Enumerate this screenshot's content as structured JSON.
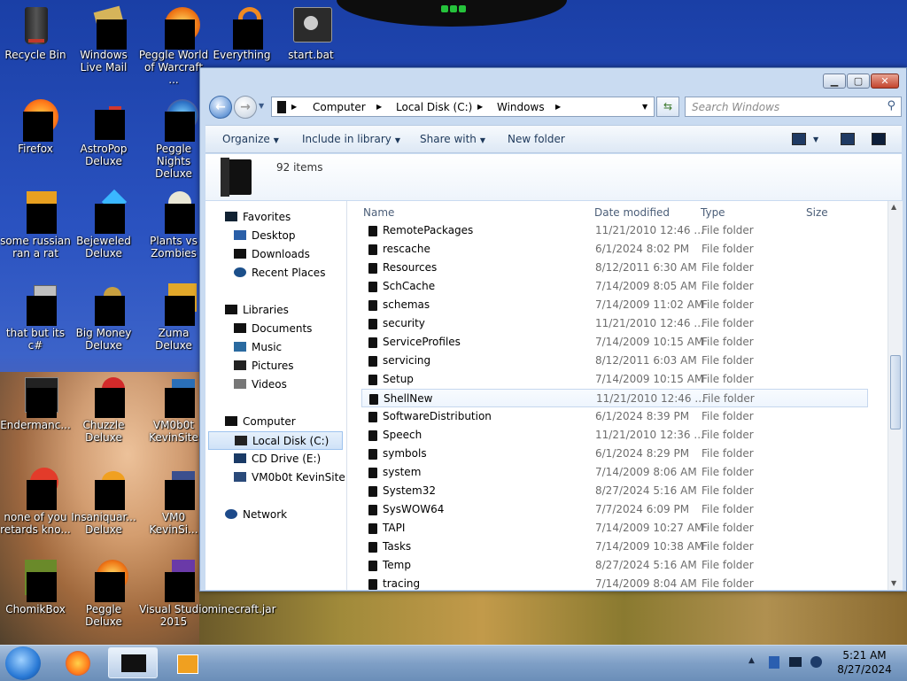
{
  "desktop": {
    "icons": [
      {
        "name": "recycle-bin",
        "label": "Recycle Bin"
      },
      {
        "name": "windows-live-mail",
        "label": "Windows Live Mail"
      },
      {
        "name": "peggle-world-of-warcraft",
        "label": "Peggle World of Warcraft ..."
      },
      {
        "name": "everything",
        "label": "Everything"
      },
      {
        "name": "start-bat",
        "label": "start.bat"
      },
      {
        "name": "firefox",
        "label": "Firefox"
      },
      {
        "name": "astropop-deluxe",
        "label": "AstroPop Deluxe"
      },
      {
        "name": "peggle-nights-deluxe",
        "label": "Peggle Nights Deluxe"
      },
      {
        "name": "some-russian-ran-a-rat",
        "label": "some russian ran a rat"
      },
      {
        "name": "bejeweled-deluxe",
        "label": "Bejeweled Deluxe"
      },
      {
        "name": "plants-vs-zombies",
        "label": "Plants vs Zombies"
      },
      {
        "name": "that-but-its-csharp",
        "label": "that but its c#"
      },
      {
        "name": "big-money-deluxe",
        "label": "Big Money Deluxe"
      },
      {
        "name": "zuma-deluxe",
        "label": "Zuma Deluxe"
      },
      {
        "name": "endermanc",
        "label": "Endermanc..."
      },
      {
        "name": "chuzzle-deluxe",
        "label": "Chuzzle Deluxe"
      },
      {
        "name": "vm0b0t-kevinsite",
        "label": "VM0b0t KevinSite"
      },
      {
        "name": "none-of-you",
        "label": "none of you retards kno..."
      },
      {
        "name": "insaniquarium-deluxe",
        "label": "Insaniquar... Deluxe"
      },
      {
        "name": "vm0-kevinsi",
        "label": "VM0 KevinSi..."
      },
      {
        "name": "chomikbox",
        "label": "ChomikBox"
      },
      {
        "name": "peggle-deluxe",
        "label": "Peggle Deluxe"
      },
      {
        "name": "visual-studio-2015",
        "label": "Visual Studio 2015"
      },
      {
        "name": "minecraft-jar",
        "label": "minecraft.jar"
      }
    ]
  },
  "explorer": {
    "breadcrumb": [
      "Computer",
      "Local Disk (C:)",
      "Windows"
    ],
    "search_placeholder": "Search Windows",
    "toolbar": {
      "organize": "Organize",
      "include_in_library": "Include in library",
      "share_with": "Share with",
      "new_folder": "New folder"
    },
    "item_count": "92 items",
    "nav": {
      "favorites": "Favorites",
      "desktop": "Desktop",
      "downloads": "Downloads",
      "recent_places": "Recent Places",
      "libraries": "Libraries",
      "documents": "Documents",
      "music": "Music",
      "pictures": "Pictures",
      "videos": "Videos",
      "computer": "Computer",
      "local_disk": "Local Disk (C:)",
      "cd_drive": "CD Drive (E:)",
      "vm_site": "VM0b0t KevinSite",
      "network": "Network"
    },
    "columns": {
      "name": "Name",
      "date": "Date modified",
      "type": "Type",
      "size": "Size"
    },
    "rows": [
      {
        "name": "RemotePackages",
        "date": "11/21/2010 12:46 ...",
        "type": "File folder"
      },
      {
        "name": "rescache",
        "date": "6/1/2024 8:02 PM",
        "type": "File folder"
      },
      {
        "name": "Resources",
        "date": "8/12/2011 6:30 AM",
        "type": "File folder"
      },
      {
        "name": "SchCache",
        "date": "7/14/2009 8:05 AM",
        "type": "File folder"
      },
      {
        "name": "schemas",
        "date": "7/14/2009 11:02 AM",
        "type": "File folder"
      },
      {
        "name": "security",
        "date": "11/21/2010 12:46 ...",
        "type": "File folder"
      },
      {
        "name": "ServiceProfiles",
        "date": "7/14/2009 10:15 AM",
        "type": "File folder"
      },
      {
        "name": "servicing",
        "date": "8/12/2011 6:03 AM",
        "type": "File folder"
      },
      {
        "name": "Setup",
        "date": "7/14/2009 10:15 AM",
        "type": "File folder"
      },
      {
        "name": "ShellNew",
        "date": "11/21/2010 12:46 ...",
        "type": "File folder"
      },
      {
        "name": "SoftwareDistribution",
        "date": "6/1/2024 8:39 PM",
        "type": "File folder"
      },
      {
        "name": "Speech",
        "date": "11/21/2010 12:36 ...",
        "type": "File folder"
      },
      {
        "name": "symbols",
        "date": "6/1/2024 8:29 PM",
        "type": "File folder"
      },
      {
        "name": "system",
        "date": "7/14/2009 8:06 AM",
        "type": "File folder"
      },
      {
        "name": "System32",
        "date": "8/27/2024 5:16 AM",
        "type": "File folder"
      },
      {
        "name": "SysWOW64",
        "date": "7/7/2024 6:09 PM",
        "type": "File folder"
      },
      {
        "name": "TAPI",
        "date": "7/14/2009 10:27 AM",
        "type": "File folder"
      },
      {
        "name": "Tasks",
        "date": "7/14/2009 10:38 AM",
        "type": "File folder"
      },
      {
        "name": "Temp",
        "date": "8/27/2024 5:16 AM",
        "type": "File folder"
      },
      {
        "name": "tracing",
        "date": "7/14/2009 8:04 AM",
        "type": "File folder"
      }
    ]
  },
  "taskbar": {
    "time": "5:21 AM",
    "date": "8/27/2024"
  }
}
